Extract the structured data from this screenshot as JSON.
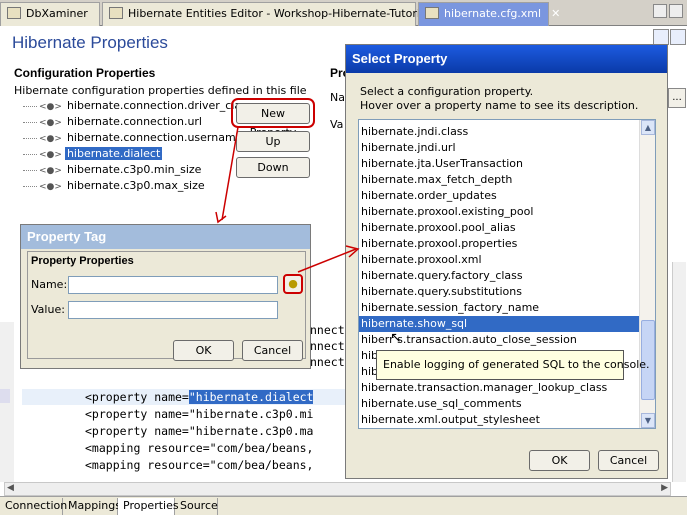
{
  "tabs": [
    {
      "label": "DbXaminer",
      "active": false
    },
    {
      "label": "Hibernate Entities Editor - Workshop-Hibernate-Tutorial",
      "active": false
    },
    {
      "label": "hibernate.cfg.xml",
      "active": true
    }
  ],
  "page_title": "Hibernate Properties",
  "config": {
    "heading": "Configuration Properties",
    "description": "Hibernate configuration properties defined in this file",
    "tree": [
      "hibernate.connection.driver_class",
      "hibernate.connection.url",
      "hibernate.connection.username",
      "hibernate.dialect",
      "hibernate.c3p0.min_size",
      "hibernate.c3p0.max_size"
    ],
    "selected": "hibernate.dialect",
    "tag_glyph": "<●>"
  },
  "buttons": {
    "new_property": "New Property",
    "up": "Up",
    "down": "Down"
  },
  "right_panel": {
    "heading": "Pro",
    "name_label": "Na",
    "value_label": "Va"
  },
  "property_tag": {
    "title": "Property Tag",
    "section": "Property Properties",
    "name_label": "Name:",
    "value_label": "Value:",
    "name_value": "",
    "value_value": "",
    "ok": "OK",
    "cancel": "Cancel"
  },
  "select_property": {
    "title": "Select Property",
    "instructions_1": "Select a configuration property.",
    "instructions_2": "Hover over a property name to see its description.",
    "items": [
      "hibernate.jndi.class",
      "hibernate.jndi.url",
      "hibernate.jta.UserTransaction",
      "hibernate.max_fetch_depth",
      "hibernate.order_updates",
      "hibernate.proxool.existing_pool",
      "hibernate.proxool.pool_alias",
      "hibernate.proxool.properties",
      "hibernate.proxool.xml",
      "hibernate.query.factory_class",
      "hibernate.query.substitutions",
      "hibernate.session_factory_name",
      "hibernate.show_sql",
      "hibernate.transaction.auto_close_session",
      "hibernate.transaction.factory_class",
      "hibernate.transaction.flush_before_completion",
      "hibernate.transaction.manager_lookup_class",
      "hibernate.use_sql_comments",
      "hibernate.xml.output_stylesheet"
    ],
    "visible_items": [
      "hibernate.jndi.class",
      "hibernate.jndi.url",
      "hibernate.jta.UserTransaction",
      "hibernate.max_fetch_depth",
      "hibernate.order_updates",
      "hibernate.proxool.existing_pool",
      "hibernate.proxool.pool_alias",
      "hibernate.proxool.properties",
      "hibernate.proxool.xml",
      "hibernate.query.factory_class",
      "hibernate.query.substitutions",
      "hibernate.session_factory_name",
      "hibernate.show_sql",
      "hiberr     s.transaction.auto_close_session",
      "hibe",
      "hibe",
      "hibernate.transaction.manager_lookup_class",
      "hibernate.use_sql_comments",
      "hibernate.xml.output_stylesheet"
    ],
    "selected": "hibernate.show_sql",
    "tooltip": "Enable logging of generated SQL to the console.",
    "ok": "OK",
    "cancel": "Cancel"
  },
  "source_lines": [
    {
      "text": "nnect"
    },
    {
      "text": "nnect"
    },
    {
      "text": "nnect"
    },
    {
      "prefix": "<property name=",
      "highlight": "\"hibernate.dialect"
    },
    {
      "text": "<property name=\"hibernate.c3p0.mi"
    },
    {
      "text": "<property name=\"hibernate.c3p0.ma"
    },
    {
      "text": "<mapping resource=\"com/bea/beans,"
    },
    {
      "text": "<mapping resource=\"com/bea/beans,"
    }
  ],
  "bottom_tabs": [
    {
      "label": "Connection",
      "active": false
    },
    {
      "label": "Mappings",
      "active": false
    },
    {
      "label": "Properties",
      "active": true
    },
    {
      "label": "Source",
      "active": false
    }
  ],
  "colors": {
    "accent": "#316ac5",
    "title_blue": "#2b4a9a",
    "callout_red": "#cc0000",
    "tooltip_bg": "#ffffe1"
  }
}
